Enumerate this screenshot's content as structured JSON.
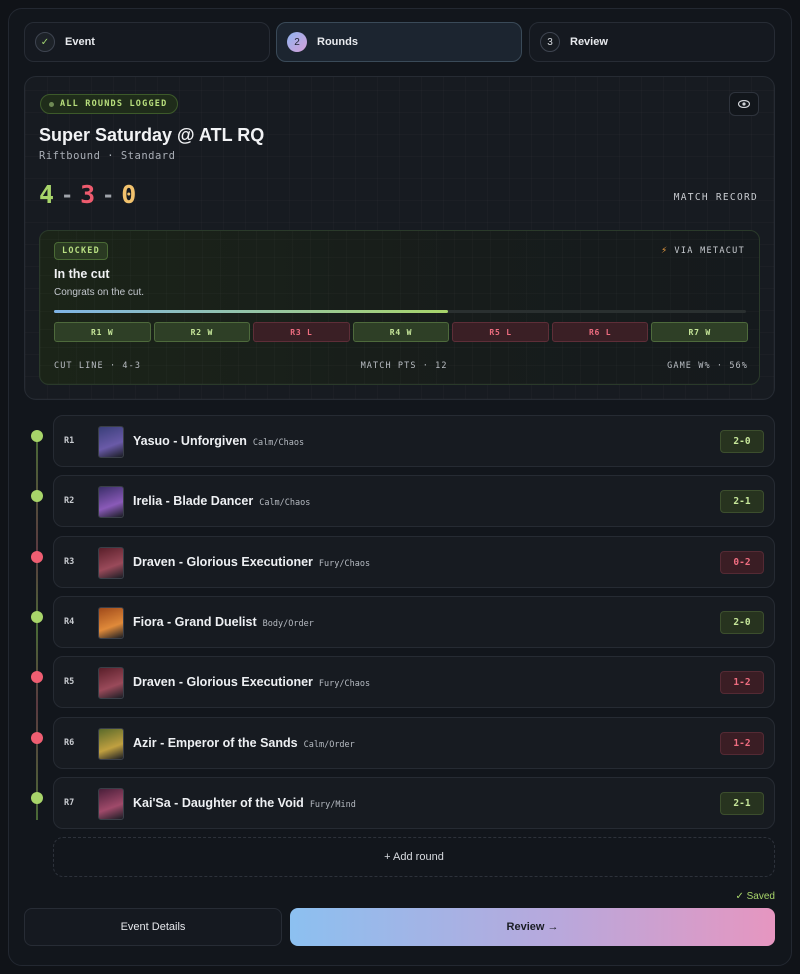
{
  "stepper": {
    "steps": [
      {
        "number": "✓",
        "label": "Event",
        "state": "done"
      },
      {
        "number": "2",
        "label": "Rounds",
        "state": "active"
      },
      {
        "number": "3",
        "label": "Review",
        "state": "pending"
      }
    ]
  },
  "summary": {
    "status": "ALL ROUNDS LOGGED",
    "title": "Super Saturday @ ATL RQ",
    "subtitle": "Riftbound · Standard",
    "record": {
      "wins": "4",
      "losses": "3",
      "draws": "0",
      "separator": "-"
    },
    "record_label": "MATCH RECORD",
    "cut": {
      "badge": "LOCKED",
      "source": "VIA METACUT",
      "title": "In the cut",
      "message": "Congrats on the cut.",
      "progress": 0.57,
      "chips": [
        {
          "label": "R1 W",
          "result": "win"
        },
        {
          "label": "R2 W",
          "result": "win"
        },
        {
          "label": "R3 L",
          "result": "loss"
        },
        {
          "label": "R4 W",
          "result": "win"
        },
        {
          "label": "R5 L",
          "result": "loss"
        },
        {
          "label": "R6 L",
          "result": "loss"
        },
        {
          "label": "R7 W",
          "result": "win"
        }
      ],
      "stats": {
        "cut_line": "CUT LINE · 4-3",
        "match_pts": "MATCH PTS · 12",
        "game_win": "GAME W% · 56%"
      }
    }
  },
  "rounds": [
    {
      "round": "R1",
      "opponent": "Yasuo - Unforgiven",
      "tag": "Calm/Chaos",
      "score": "2-0",
      "result": "win",
      "art": [
        "#3a3f7a",
        "#6a5aa8"
      ]
    },
    {
      "round": "R2",
      "opponent": "Irelia - Blade Dancer",
      "tag": "Calm/Chaos",
      "score": "2-1",
      "result": "win",
      "art": [
        "#3b2f6a",
        "#8a5ab8"
      ]
    },
    {
      "round": "R3",
      "opponent": "Draven - Glorious Executioner",
      "tag": "Fury/Chaos",
      "score": "0-2",
      "result": "loss",
      "art": [
        "#5a1f2a",
        "#9a4a5a"
      ]
    },
    {
      "round": "R4",
      "opponent": "Fiora - Grand Duelist",
      "tag": "Body/Order",
      "score": "2-0",
      "result": "win",
      "art": [
        "#a04a1a",
        "#e08a3a"
      ]
    },
    {
      "round": "R5",
      "opponent": "Draven - Glorious Executioner",
      "tag": "Fury/Chaos",
      "score": "1-2",
      "result": "loss",
      "art": [
        "#5a1f2a",
        "#9a4a5a"
      ]
    },
    {
      "round": "R6",
      "opponent": "Azir - Emperor of the Sands",
      "tag": "Calm/Order",
      "score": "1-2",
      "result": "loss",
      "art": [
        "#5a6a2a",
        "#c0a040"
      ]
    },
    {
      "round": "R7",
      "opponent": "Kai'Sa - Daughter of the Void",
      "tag": "Fury/Mind",
      "score": "2-1",
      "result": "win",
      "art": [
        "#4a1f3a",
        "#a04a6a"
      ]
    }
  ],
  "add_round_label": "+ Add round",
  "saved_label": "✓ Saved",
  "footer": {
    "details_label": "Event Details",
    "review_label": "Review →"
  },
  "icons": {
    "eye": "eye-icon",
    "bolt": "bolt-icon",
    "check": "check-icon"
  }
}
